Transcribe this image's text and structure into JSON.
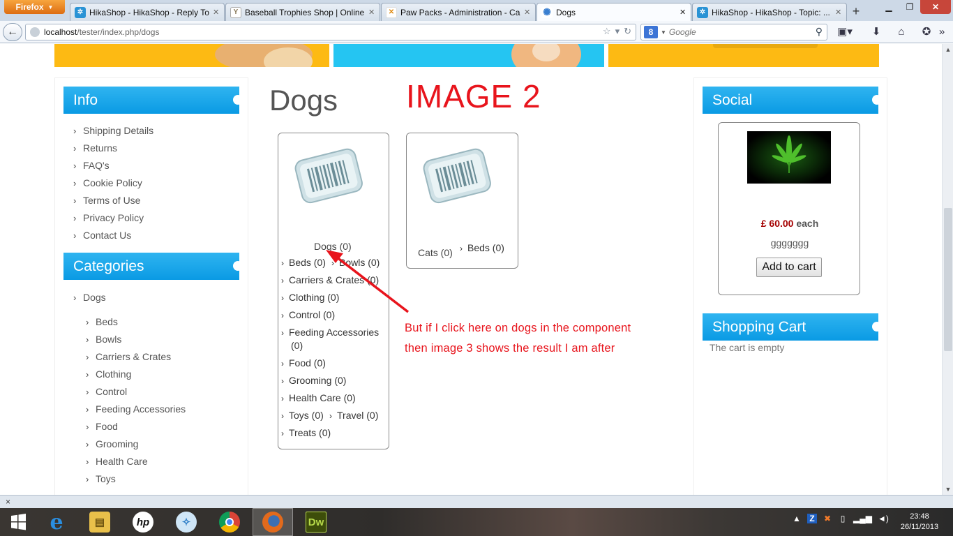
{
  "browser": {
    "menu_button": "Firefox",
    "tabs": [
      {
        "title": "HikaShop - HikaShop - Reply To...",
        "favicon_color": "#2a93d5",
        "favicon_char": "✲",
        "active": false
      },
      {
        "title": "Baseball Trophies Shop | Online ...",
        "favicon_color": "#9a8b6a",
        "favicon_char": "Y",
        "active": false
      },
      {
        "title": "Paw Packs - Administration - Ca...",
        "favicon_color": "#f0a020",
        "favicon_char": "✕",
        "active": false
      },
      {
        "title": "Dogs",
        "favicon_color": "#3a7fd0",
        "favicon_char": "✺",
        "active": true
      },
      {
        "title": "HikaShop - HikaShop - Topic: ...",
        "favicon_color": "#2a93d5",
        "favicon_char": "✲",
        "active": false
      }
    ],
    "url_host": "localhost",
    "url_path": "/tester/index.php/dogs",
    "search_placeholder": "Google",
    "search_engine_letter": "8"
  },
  "page": {
    "title": "Dogs",
    "annotation_title": "IMAGE  2",
    "annotation_text_line1": "But if I click here on dogs in the component",
    "annotation_text_line2": "then image 3 shows the result I am after",
    "annotation_color": "#e8141c"
  },
  "info_module": {
    "heading": "Info",
    "items": [
      "Shipping Details",
      "Returns",
      "FAQ's",
      "Cookie Policy",
      "Terms of Use",
      "Privacy Policy",
      "Contact Us"
    ]
  },
  "categories_module": {
    "heading": "Categories",
    "root": "Dogs",
    "children": [
      "Beds",
      "Bowls",
      "Carriers & Crates",
      "Clothing",
      "Control",
      "Feeding Accessories",
      "Food",
      "Grooming",
      "Health Care",
      "Toys"
    ]
  },
  "category_boxes": {
    "dogs": {
      "label": "Dogs (0)",
      "subcategories": {
        "beds": "Beds (0)",
        "bowls": "Bowls (0)",
        "carriers": "Carriers & Crates (0)",
        "clothing": "Clothing (0)",
        "control": "Control (0)",
        "feeding_line1": "Feeding Accessories",
        "feeding_line2": "(0)",
        "food": "Food (0)",
        "grooming": "Grooming (0)",
        "health": "Health Care (0)",
        "toys": "Toys (0)",
        "travel": "Travel (0)",
        "treats": "Treats (0)"
      }
    },
    "cats": {
      "label": "Cats (0)",
      "subcategory": "Beds (0)"
    }
  },
  "social_module": {
    "heading": "Social",
    "product": {
      "price": "£ 60.00",
      "price_suffix": "each",
      "name": "ggggggg",
      "button": "Add to cart"
    }
  },
  "cart_module": {
    "heading": "Shopping Cart",
    "empty_text": "The cart is empty"
  },
  "statusbar": {
    "close_glyph": "×"
  },
  "taskbar": {
    "apps": [
      {
        "name": "internet-explorer",
        "char": "e",
        "color": "#1e88d6"
      },
      {
        "name": "file-explorer",
        "char": "▤",
        "color": "#e8b731"
      },
      {
        "name": "hp",
        "char": "hp",
        "color": "#0b0b0b"
      },
      {
        "name": "safari",
        "char": "✧",
        "color": "#4aa3e6"
      },
      {
        "name": "chrome",
        "char": "◉",
        "color": "#2f9e44"
      },
      {
        "name": "firefox",
        "char": "◓",
        "color": "#e2691c"
      },
      {
        "name": "dreamweaver",
        "char": "Dw",
        "color": "#4f6a0c"
      }
    ],
    "time": "23:48",
    "date": "26/11/2013"
  }
}
